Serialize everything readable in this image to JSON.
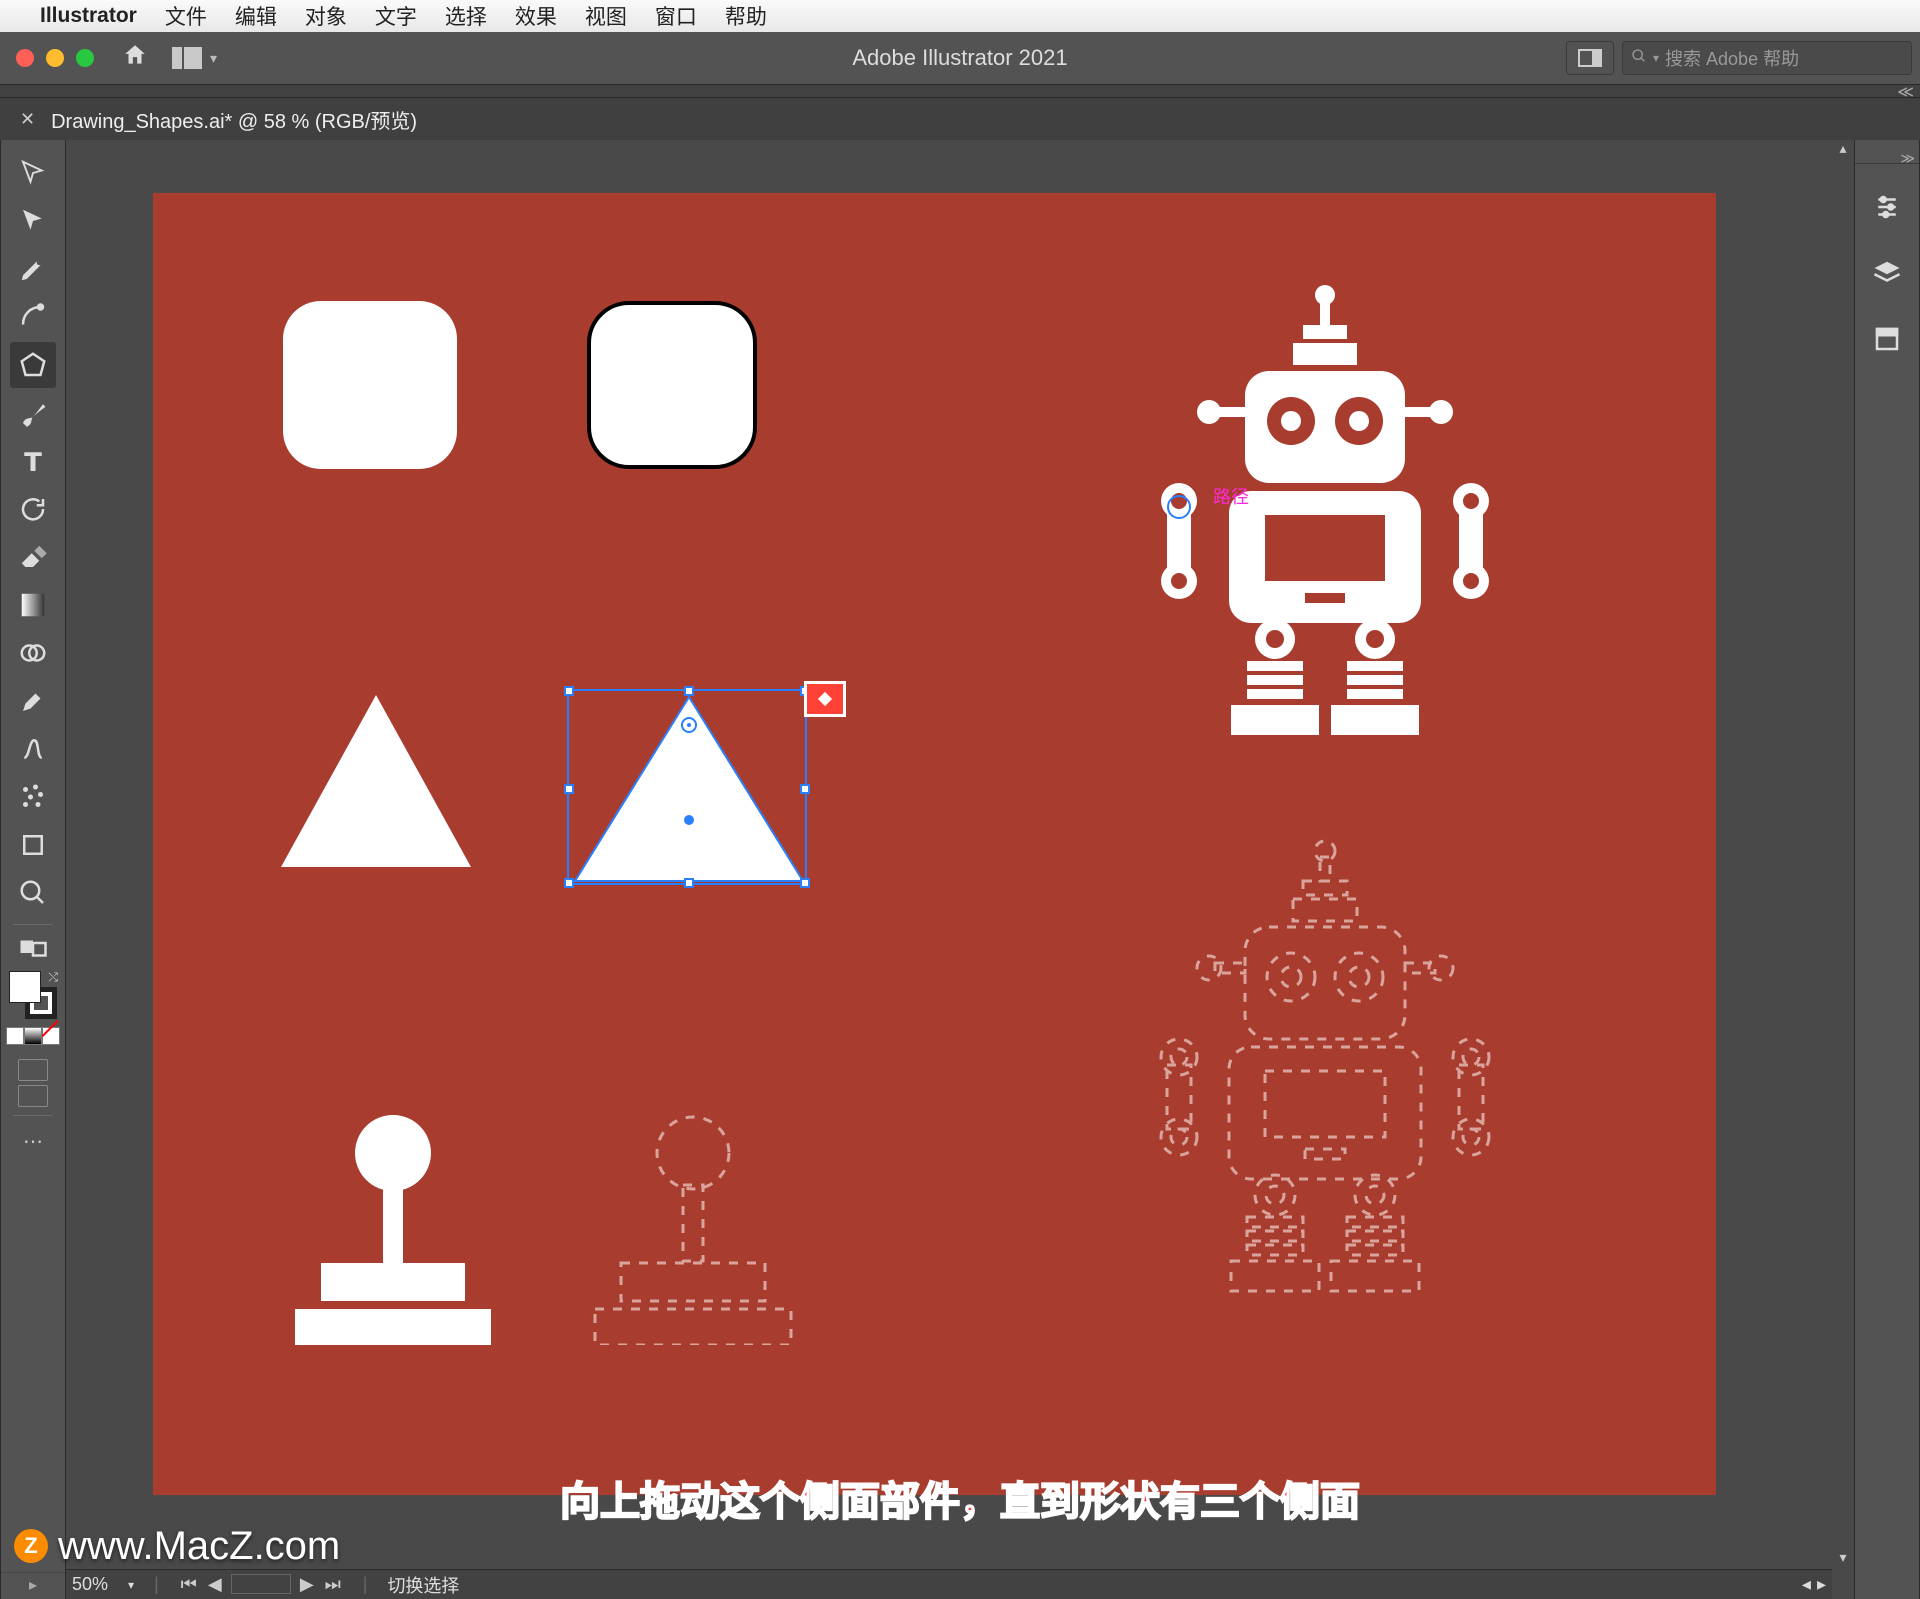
{
  "os_menu": {
    "app": "Illustrator",
    "items": [
      "文件",
      "编辑",
      "对象",
      "文字",
      "选择",
      "效果",
      "视图",
      "窗口",
      "帮助"
    ]
  },
  "app": {
    "title": "Adobe Illustrator 2021",
    "search_placeholder": "搜索 Adobe 帮助"
  },
  "document": {
    "tab_label": "Drawing_Shapes.ai* @ 58 % (RGB/预览)"
  },
  "tools_left": [
    "selection",
    "direct-selection",
    "pen",
    "curvature",
    "polygon",
    "paintbrush",
    "type",
    "rotate",
    "eraser",
    "gradient",
    "shape-builder",
    "eyedropper",
    "blend",
    "symbol-sprayer",
    "artboard",
    "zoom"
  ],
  "tools_right": [
    "properties",
    "layers",
    "libraries"
  ],
  "status": {
    "zoom": "50%",
    "switch_label": "切换选择"
  },
  "canvas": {
    "path_hint": "路径",
    "caption": "向上拖动这个侧面部件，直到形状有三个侧面",
    "artboard_bg": "#a83c2e"
  },
  "watermark": "www.MacZ.com",
  "z_badge": "Z"
}
